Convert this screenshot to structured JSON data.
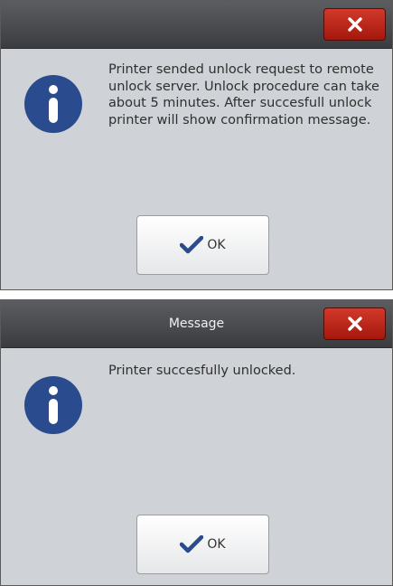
{
  "dialogs": [
    {
      "title": "",
      "message": "Printer sended unlock request to remote unlock server. Unlock procedure can take about 5 minutes. After succesfull unlock printer will show confirmation message.",
      "ok_label": "OK",
      "info_icon": "info-icon",
      "close_icon": "close-icon",
      "check_icon": "checkmark-icon"
    },
    {
      "title": "Message",
      "message": "Printer succesfully unlocked.",
      "ok_label": "OK",
      "info_icon": "info-icon",
      "close_icon": "close-icon",
      "check_icon": "checkmark-icon"
    }
  ],
  "colors": {
    "close_button": "#b82016",
    "info_icon": "#2a4b8d",
    "checkmark": "#2a4b8d",
    "dialog_background": "#cfd2d6",
    "titlebar": "#4a4c50"
  }
}
